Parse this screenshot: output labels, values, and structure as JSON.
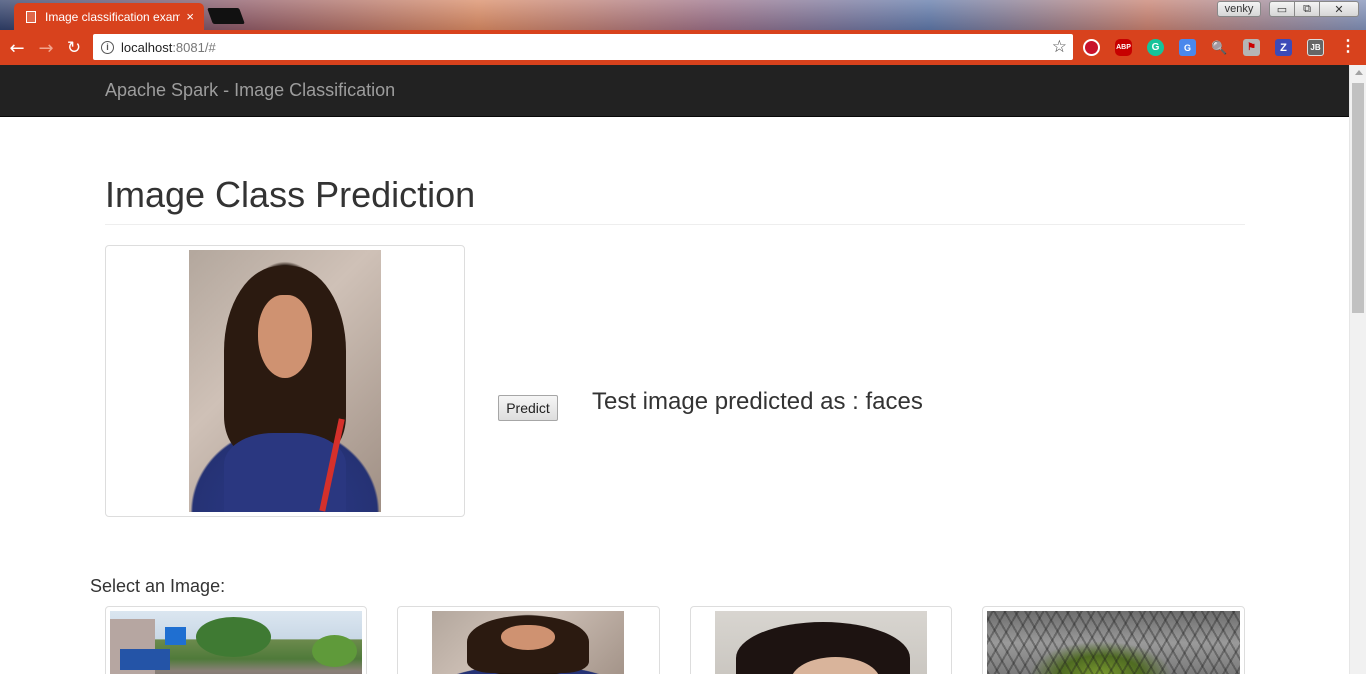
{
  "browser": {
    "tab_title": "Image classification exam",
    "tab_close": "×",
    "profile_name": "venky",
    "window_buttons": {
      "minimize": "▭",
      "maximize": "⧉",
      "close": "✕"
    },
    "url_host": "localhost",
    "url_rest": ":8081/#",
    "nav": {
      "back": "←",
      "forward": "→",
      "reload": "↻",
      "star": "☆",
      "info": "i",
      "menu": "⋮"
    },
    "extensions": [
      {
        "name": "opera-icon",
        "glyph": "",
        "color": "#c9122a"
      },
      {
        "name": "adblock-icon",
        "glyph": "ABP",
        "color": "#c70000"
      },
      {
        "name": "grammarly-icon",
        "glyph": "G",
        "color": "#15c39a"
      },
      {
        "name": "google-translate-icon",
        "glyph": "G",
        "color": "#4a88ec"
      },
      {
        "name": "zoom-icon",
        "glyph": "🔍",
        "color": "#ffffff"
      },
      {
        "name": "pdf-icon",
        "glyph": "⚑",
        "color": "#b5b5b5"
      },
      {
        "name": "z-extension-icon",
        "glyph": "Z",
        "color": "#3c4ab8"
      },
      {
        "name": "jb-extension-icon",
        "glyph": "JB",
        "color": "#666666"
      }
    ],
    "accent_color": "#d8421d"
  },
  "navbar": {
    "brand": "Apache Spark - Image Classification",
    "background": "#222222"
  },
  "main": {
    "page_title": "Image Class Prediction",
    "predict_button": "Predict",
    "prediction_text": "Test image predicted as : faces",
    "select_label": "Select an Image:",
    "test_image": "portrait-photo",
    "gallery": [
      {
        "subject": "street-scene"
      },
      {
        "subject": "portrait-photo"
      },
      {
        "subject": "portrait-photo"
      },
      {
        "subject": "tree-photo"
      }
    ]
  }
}
